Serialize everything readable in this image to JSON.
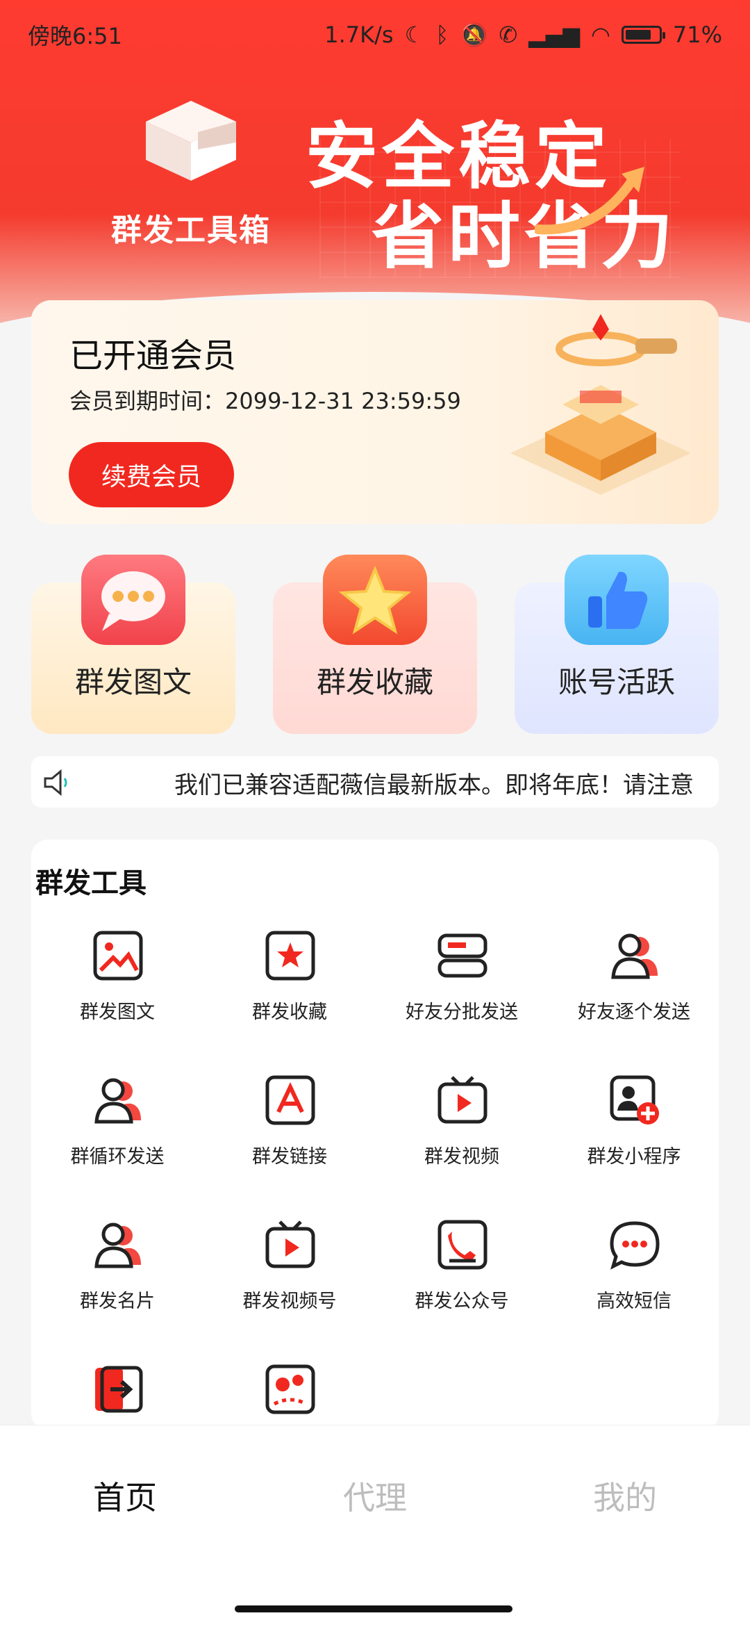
{
  "status_bar": {
    "time": "傍晚6:51",
    "network_speed": "1.7K/s",
    "battery_percent": "71%"
  },
  "hero": {
    "logo_text": "群发工具箱",
    "headline_1": "安全稳定",
    "headline_2": "省时省力"
  },
  "member": {
    "title": "已开通会员",
    "expire_text": "会员到期时间：2099-12-31 23:59:59",
    "renew_label": "续费会员"
  },
  "feature_cards": [
    {
      "label": "群发图文",
      "icon": "chat-bubble-icon"
    },
    {
      "label": "群发收藏",
      "icon": "star-icon"
    },
    {
      "label": "账号活跃",
      "icon": "thumbs-up-icon"
    }
  ],
  "notice": {
    "text": "我们已兼容适配薇信最新版本。即将年底！请注意"
  },
  "tools": {
    "title": "群发工具",
    "items": [
      {
        "label": "群发图文",
        "icon": "image-icon"
      },
      {
        "label": "群发收藏",
        "icon": "star-box-icon"
      },
      {
        "label": "好友分批发送",
        "icon": "batch-icon"
      },
      {
        "label": "好友逐个发送",
        "icon": "user-icon"
      },
      {
        "label": "群循环发送",
        "icon": "user-icon"
      },
      {
        "label": "群发链接",
        "icon": "link-icon"
      },
      {
        "label": "群发视频",
        "icon": "video-icon"
      },
      {
        "label": "群发小程序",
        "icon": "mini-program-icon"
      },
      {
        "label": "群发名片",
        "icon": "user-icon"
      },
      {
        "label": "群发视频号",
        "icon": "video-icon"
      },
      {
        "label": "群发公众号",
        "icon": "phone-icon"
      },
      {
        "label": "高效短信",
        "icon": "sms-icon"
      },
      {
        "label": "",
        "icon": "exit-icon"
      },
      {
        "label": "",
        "icon": "location-icon"
      }
    ]
  },
  "bottom_nav": {
    "home": "首页",
    "agent": "代理",
    "mine": "我的"
  },
  "colors": {
    "brand_red": "#f1281f",
    "hero_red": "#ff3b30"
  }
}
